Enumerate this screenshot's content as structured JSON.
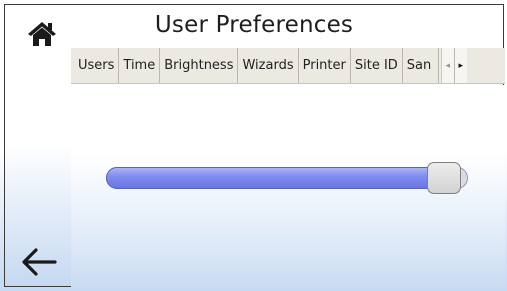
{
  "header": {
    "title": "User Preferences",
    "home_icon": "home-icon",
    "back_icon": "arrow-left-icon"
  },
  "tabs": [
    {
      "label": "Users"
    },
    {
      "label": "Time"
    },
    {
      "label": "Brightness"
    },
    {
      "label": "Wizards"
    },
    {
      "label": "Printer"
    },
    {
      "label": "Site ID"
    },
    {
      "label": "San"
    }
  ],
  "tab_scroll": {
    "left_glyph": "◂",
    "right_glyph": "▸"
  },
  "brightness": {
    "level": 0.97
  },
  "colors": {
    "slider_fill": "#7e8bf0",
    "tab_bar": "#ece9e3",
    "background_bottom": "#c6d9f2"
  }
}
